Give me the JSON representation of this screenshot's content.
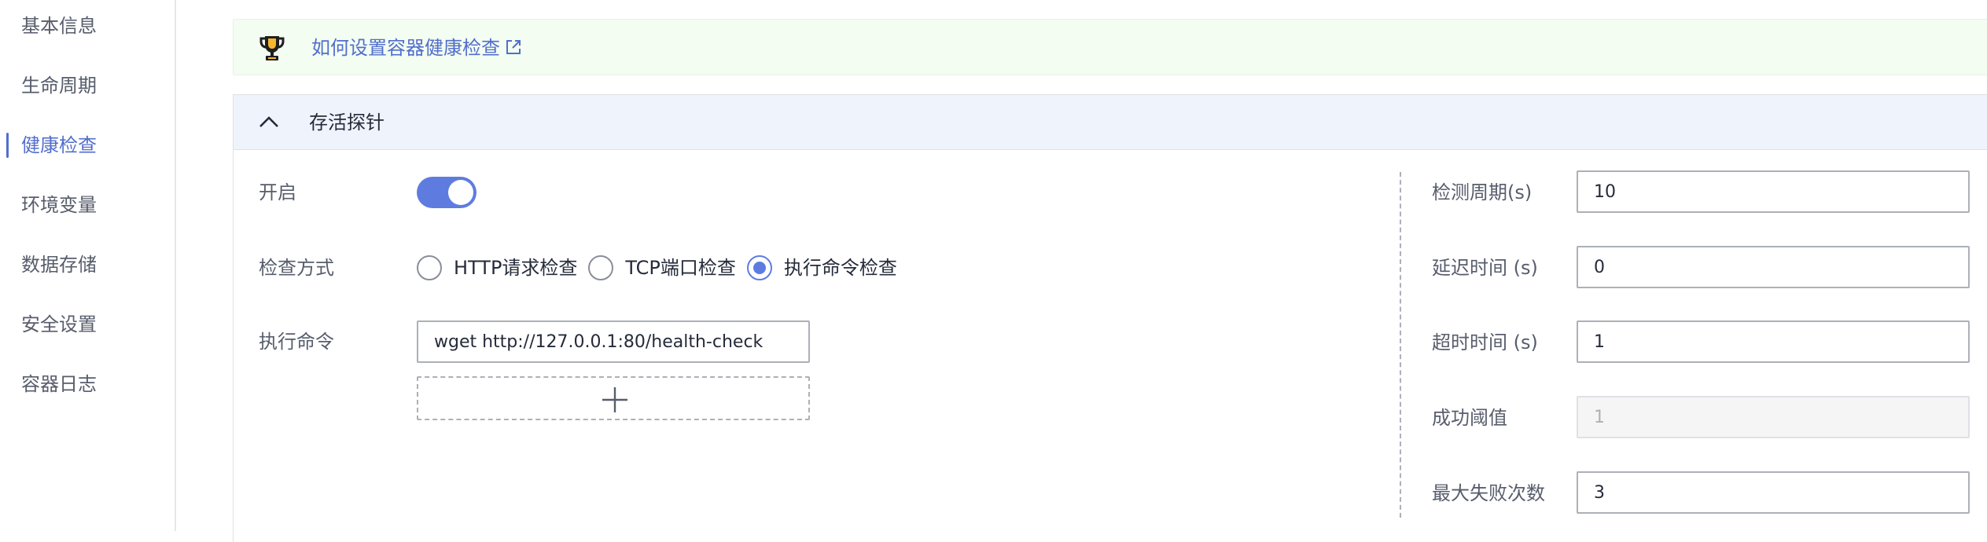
{
  "sidebar": {
    "items": [
      {
        "label": "基本信息"
      },
      {
        "label": "生命周期"
      },
      {
        "label": "健康检查"
      },
      {
        "label": "环境变量"
      },
      {
        "label": "数据存储"
      },
      {
        "label": "安全设置"
      },
      {
        "label": "容器日志"
      }
    ],
    "active_index": 2
  },
  "tip": {
    "link_text": "如何设置容器健康检查",
    "icon": "trophy-icon",
    "link_icon": "external-link-icon"
  },
  "panel": {
    "title": "存活探针",
    "expanded": true,
    "left": {
      "enable_label": "开启",
      "enable_value": true,
      "method_label": "检查方式",
      "methods": [
        "HTTP请求检查",
        "TCP端口检查",
        "执行命令检查"
      ],
      "method_selected": "执行命令检查",
      "command_label": "执行命令",
      "command_value": "wget http://127.0.0.1:80/health-check"
    },
    "right": {
      "period_label": "检测周期(s)",
      "period_value": "10",
      "delay_label": "延迟时间 (s)",
      "delay_value": "0",
      "timeout_label": "超时时间 (s)",
      "timeout_value": "1",
      "success_label": "成功阈值",
      "success_value": "1",
      "failure_label": "最大失败次数",
      "failure_value": "3"
    }
  },
  "colors": {
    "accent": "#5e7ce0",
    "link": "#526ecc",
    "tip_background": "#f3fdf2",
    "header_background": "#eff3fc"
  }
}
